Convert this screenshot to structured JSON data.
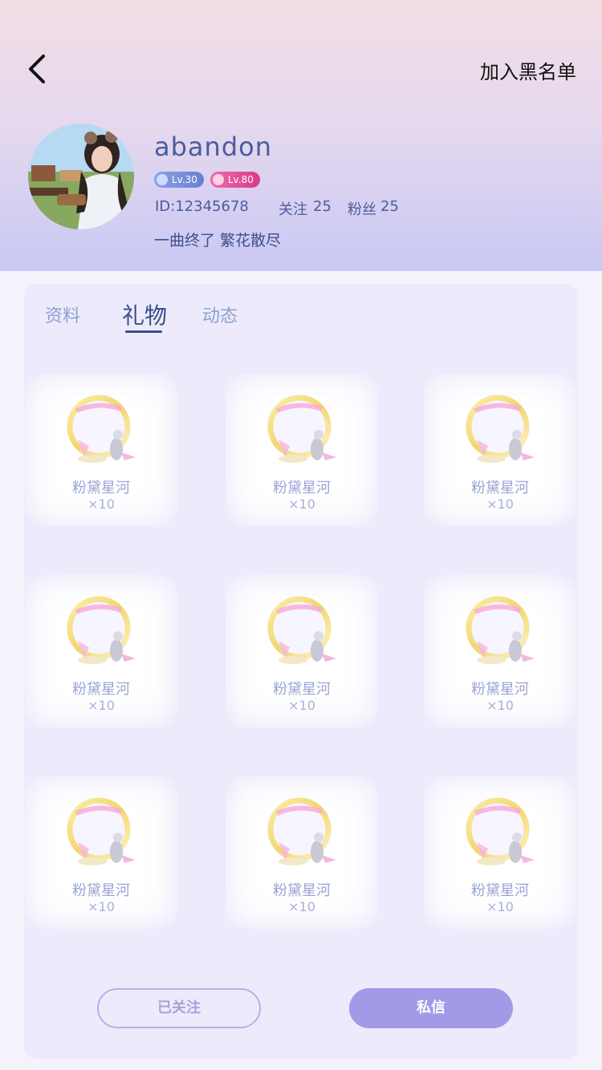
{
  "header": {
    "back_icon": "chevron-left-icon",
    "blacklist_label": "加入黑名单"
  },
  "profile": {
    "nickname": "abandon",
    "badges": [
      {
        "label": "Lv.30",
        "color": "#7387d6"
      },
      {
        "label": "Lv.80",
        "color": "#e0448f"
      }
    ],
    "id_text": "ID:12345678",
    "follow_label": "关注",
    "follow_count": "25",
    "fans_label": "粉丝",
    "fans_count": "25",
    "signature": "一曲终了 繁花散尽"
  },
  "tabs": [
    {
      "label": "资料",
      "active": false
    },
    {
      "label": "礼物",
      "active": true
    },
    {
      "label": "动态",
      "active": false
    }
  ],
  "gifts": [
    {
      "name": "粉黛星河",
      "count": "×10"
    },
    {
      "name": "粉黛星河",
      "count": "×10"
    },
    {
      "name": "粉黛星河",
      "count": "×10"
    },
    {
      "name": "粉黛星河",
      "count": "×10"
    },
    {
      "name": "粉黛星河",
      "count": "×10"
    },
    {
      "name": "粉黛星河",
      "count": "×10"
    },
    {
      "name": "粉黛星河",
      "count": "×10"
    },
    {
      "name": "粉黛星河",
      "count": "×10"
    },
    {
      "name": "粉黛星河",
      "count": "×10"
    }
  ],
  "actions": {
    "followed_label": "已关注",
    "message_label": "私信"
  },
  "colors": {
    "accent": "#a29ae6",
    "text_primary": "#4b5d9a"
  }
}
